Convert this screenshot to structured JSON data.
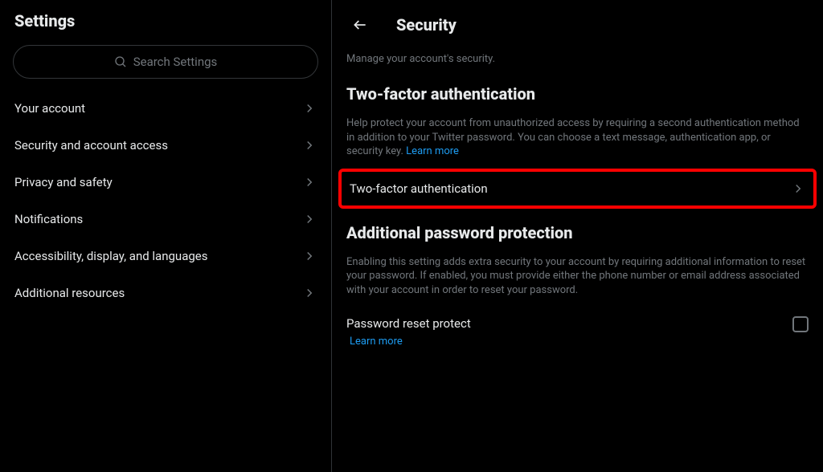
{
  "sidebar": {
    "title": "Settings",
    "search_placeholder": "Search Settings",
    "items": [
      {
        "label": "Your account"
      },
      {
        "label": "Security and account access"
      },
      {
        "label": "Privacy and safety"
      },
      {
        "label": "Notifications"
      },
      {
        "label": "Accessibility, display, and languages"
      },
      {
        "label": "Additional resources"
      }
    ]
  },
  "main": {
    "title": "Security",
    "subtitle": "Manage your account's security.",
    "section1": {
      "heading": "Two-factor authentication",
      "desc": "Help protect your account from unauthorized access by requiring a second authentication method in addition to your Twitter password. You can choose a text message, authentication app, or security key. ",
      "learn_more": "Learn more",
      "row_label": "Two-factor authentication"
    },
    "section2": {
      "heading": "Additional password protection",
      "desc": "Enabling this setting adds extra security to your account by requiring additional information to reset your password. If enabled, you must provide either the phone number or email address associated with your account in order to reset your password.",
      "toggle_label": "Password reset protect",
      "learn_more": "Learn more"
    }
  }
}
